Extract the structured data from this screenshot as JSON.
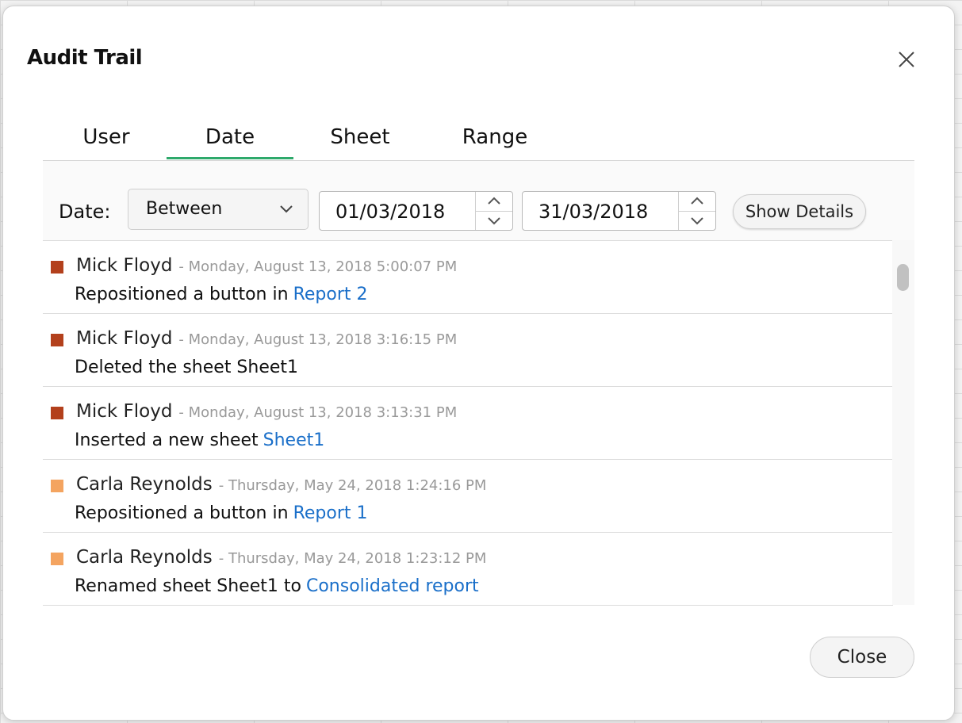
{
  "dialog": {
    "title": "Audit Trail",
    "close_icon": "close-icon"
  },
  "tabs": [
    {
      "label": "User",
      "active": false
    },
    {
      "label": "Date",
      "active": true
    },
    {
      "label": "Sheet",
      "active": false
    },
    {
      "label": "Range",
      "active": false
    }
  ],
  "filter": {
    "label": "Date:",
    "mode": "Between",
    "from_date": "01/03/2018",
    "to_date": "31/03/2018",
    "show_details_label": "Show Details"
  },
  "entries": [
    {
      "user": "Mick Floyd",
      "timestamp": "- Monday, August 13, 2018 5:00:07 PM",
      "action": "Repositioned a button in",
      "link": "Report 2",
      "color": "#b3401c"
    },
    {
      "user": "Mick Floyd",
      "timestamp": "- Monday, August 13, 2018 3:16:15 PM",
      "action": "Deleted the sheet Sheet1",
      "link": "",
      "color": "#b3401c"
    },
    {
      "user": "Mick Floyd",
      "timestamp": "- Monday, August 13, 2018 3:13:31 PM",
      "action": "Inserted a new sheet",
      "link": "Sheet1",
      "color": "#b3401c"
    },
    {
      "user": "Carla Reynolds",
      "timestamp": "- Thursday, May 24, 2018 1:24:16 PM",
      "action": "Repositioned a button in",
      "link": "Report 1",
      "color": "#f4a460"
    },
    {
      "user": "Carla Reynolds",
      "timestamp": "- Thursday, May 24, 2018 1:23:12 PM",
      "action": "Renamed sheet Sheet1 to",
      "link": "Consolidated report",
      "color": "#f4a460"
    }
  ],
  "footer": {
    "close_label": "Close"
  },
  "colors": {
    "accent_tab": "#2ea96b",
    "link": "#1a6fc9"
  }
}
